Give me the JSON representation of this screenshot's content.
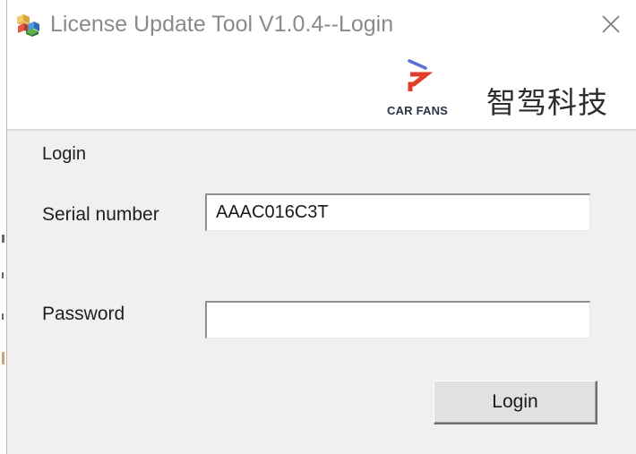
{
  "window": {
    "title": "License Update Tool V1.0.4--Login",
    "app_icon": "colored-cubes-icon",
    "close_icon": "close-icon"
  },
  "brand": {
    "logo_icon": "car-fans-logo-icon",
    "logo_text": "CAR FANS",
    "company_name": "智驾科技",
    "colors": {
      "logo_blue": "#5b6fd6",
      "logo_red": "#e23b2a",
      "logo_text": "#2b3346"
    }
  },
  "form": {
    "group_title": "Login",
    "serial_label": "Serial number",
    "serial_value": "AAAC016C3T",
    "password_label": "Password",
    "password_value": "",
    "login_button": "Login"
  },
  "colors": {
    "panel_background": "#f0f0f0",
    "title_text": "#8a8a8a"
  }
}
